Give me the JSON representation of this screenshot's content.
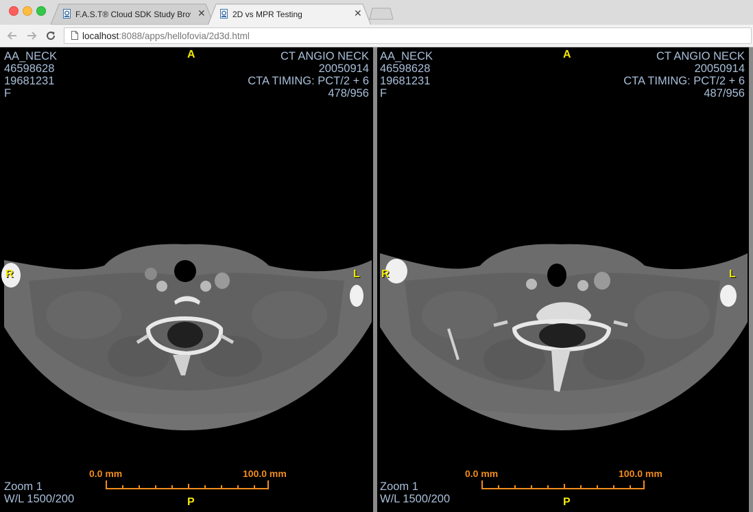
{
  "browser": {
    "tabs": [
      {
        "title": "F.A.S.T® Cloud SDK Study Brov",
        "active": false
      },
      {
        "title": "2D vs MPR Testing",
        "active": true
      }
    ],
    "url_host": "localhost",
    "url_rest": ":8088/apps/hellofovia/2d3d.html"
  },
  "colors": {
    "overlay_text": "#a9bfd9",
    "orientation_marker": "#f3e80a",
    "scale_bar": "#f28c1c"
  },
  "viewports": [
    {
      "patient_name": "AA_NECK",
      "patient_id": "46598628",
      "birth_date": "19681231",
      "sex": "F",
      "study_description": "CT ANGIO NECK",
      "study_date": "20050914",
      "series_description": "CTA TIMING: PCT/2 + 6",
      "slice_index": "478/956",
      "orient_top": "A",
      "orient_bottom": "P",
      "orient_left": "R",
      "orient_right": "L",
      "zoom": "Zoom 1",
      "window_level": "W/L 1500/200",
      "scale_start": "0.0 mm",
      "scale_end": "100.0 mm"
    },
    {
      "patient_name": "AA_NECK",
      "patient_id": "46598628",
      "birth_date": "19681231",
      "sex": "F",
      "study_description": "CT ANGIO NECK",
      "study_date": "20050914",
      "series_description": "CTA TIMING: PCT/2 + 6",
      "slice_index": "487/956",
      "orient_top": "A",
      "orient_bottom": "P",
      "orient_left": "R",
      "orient_right": "L",
      "zoom": "Zoom 1",
      "window_level": "W/L 1500/200",
      "scale_start": "0.0 mm",
      "scale_end": "100.0 mm"
    }
  ]
}
